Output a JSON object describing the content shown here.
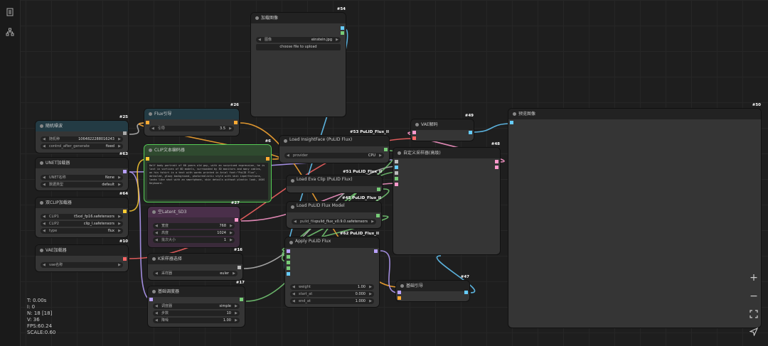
{
  "sidebar": {
    "items": [
      {
        "icon": "document-icon"
      },
      {
        "icon": "node-library-icon"
      }
    ]
  },
  "stats": {
    "t": "T: 0.00s",
    "i": "I: 0",
    "n": "N: 18 [18]",
    "v": "V: 36",
    "fps": "FPS:60.24",
    "scale": "SCALE:0.60"
  },
  "nodes": {
    "load_image": {
      "id": "#54",
      "title": "加载图像",
      "image_label": "图像",
      "image_value": "einstein.jpg",
      "upload": "choose file to upload"
    },
    "random_seed": {
      "id": "#25",
      "title": "随机噪波",
      "seed_label": "随机种",
      "seed_value": "1064822288016243",
      "control_label": "control_after_generate",
      "control_value": "fixed"
    },
    "unet": {
      "id": "#63",
      "title": "UNET加载器",
      "name_label": "UNET名称",
      "name_value": "None",
      "dtype_label": "数据类型",
      "dtype_value": "default"
    },
    "dual_clip": {
      "id": "#64",
      "title": "双CLIP加载器",
      "clip1_label": "CLIP1",
      "clip1_value": "t5xxl_fp16.safetensors",
      "clip2_label": "CLIP2",
      "clip2_value": "clip_l.safetensors",
      "type_label": "type",
      "type_value": "flux"
    },
    "vae_loader": {
      "id": "#10",
      "title": "VAE加载器",
      "name_label": "vae名称"
    },
    "flux_guidance": {
      "id": "#26",
      "title": "Flux引导",
      "guidance_label": "引导",
      "guidance_value": "3.5"
    },
    "clip_text": {
      "id": "#6",
      "title": "CLIP文本编码器",
      "text": "Half body portrait of 60 years old guy, with an surprised expression, he is lost in vortices of 6D models, surrounded by 3D monitors and many cables, on his tshirt is a text with words printed in Arial font:\"PuLID Flux\", detailed, glowy background, photorealistic style with skin inperfections, looks like shot with an smartphone, skin details without plastic look, ASUS Keyboard."
    },
    "empty_latent": {
      "id": "#27",
      "title": "空Latent_SD3",
      "width_label": "宽度",
      "width_value": "768",
      "height_label": "高度",
      "height_value": "1024",
      "batch_label": "批次大小",
      "batch_value": "1"
    },
    "ksampler_select": {
      "id": "#16",
      "title": "K采样器选择",
      "sampler_label": "采样器",
      "sampler_value": "euler"
    },
    "basic_scheduler": {
      "id": "#17",
      "title": "基础调度器",
      "scheduler_label": "调度器",
      "scheduler_value": "simple",
      "steps_label": "步数",
      "steps_value": "10",
      "denoise_label": "降噪",
      "denoise_value": "1.00"
    },
    "insightface": {
      "id": "#53 PuLID_Flux_II",
      "title": "Load InsightFace (PuLID Flux)",
      "provider_label": "provider",
      "provider_value": "CPU"
    },
    "evaclip": {
      "id": "#51 PuLID_Flux_II",
      "title": "Load Eva Clip (PuLID Flux)"
    },
    "pulid_model": {
      "id": "#45 PuLID_Flux_II",
      "title": "Load PuLID Flux Model",
      "file_label": "pulid_file",
      "file_value": "pulid_flux_v0.9.0.safetensors"
    },
    "apply_pulid": {
      "id": "#62 PuLID_Flux_II",
      "title": "Apply PuLID Flux",
      "weight_label": "weight",
      "weight_value": "1.00",
      "start_label": "start_at",
      "start_value": "0.000",
      "end_label": "end_at",
      "end_value": "1.000"
    },
    "vae_decode": {
      "id": "#49",
      "title": "VAE解码"
    },
    "custom_sampler": {
      "id": "#48",
      "title": "自定义采样器(高级)"
    },
    "basic_guider": {
      "id": "#47",
      "title": "基础引导"
    },
    "preview": {
      "id": "#50",
      "title": "预览图像"
    }
  },
  "colors": {
    "clip_text_header": "#2f4a2f",
    "latent_header": "#4a2f4a",
    "seed_header": "#233b44",
    "accent": "#ffffff"
  }
}
